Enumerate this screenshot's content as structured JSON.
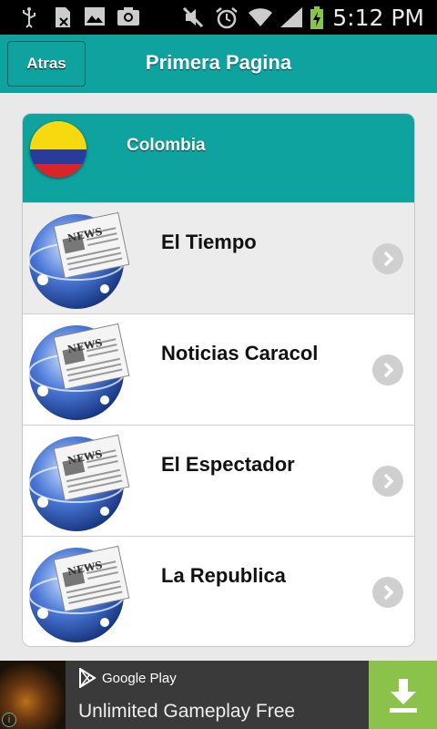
{
  "status_bar": {
    "time": "5:12 PM",
    "icons": [
      "usb-icon",
      "sim-icon",
      "image-icon",
      "camera-icon",
      "mute-icon",
      "alarm-icon",
      "wifi-icon",
      "signal-icon",
      "battery-charging-icon"
    ]
  },
  "header": {
    "back_label": "Atras",
    "title": "Primera Pagina"
  },
  "country": {
    "label": "Colombia",
    "flag_colors": [
      "#f7d90f",
      "#2a3c9b",
      "#d8242a"
    ]
  },
  "newspapers": [
    {
      "label": "El Tiempo"
    },
    {
      "label": "Noticias Caracol"
    },
    {
      "label": "El Espectador"
    },
    {
      "label": "La Republica"
    }
  ],
  "news_icon_text": "NEWS",
  "ad": {
    "store_label": "Google Play",
    "text": "Unlimited Gameplay Free",
    "info_glyph": "i",
    "accent": "#8bc34a"
  },
  "colors": {
    "accent": "#0fa3a0"
  }
}
